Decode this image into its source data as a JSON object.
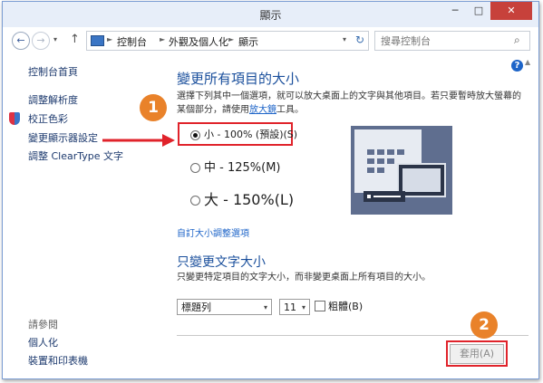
{
  "window": {
    "title": "顯示",
    "minimize": "─",
    "maximize": "□",
    "close": "✕"
  },
  "nav": {
    "back_icon": "←",
    "forward_icon": "→",
    "dropdown_icon": "▾",
    "up_icon": "↑"
  },
  "address": {
    "crumbs": [
      "控制台",
      "外觀及個人化",
      "顯示"
    ],
    "separator_icon": "►",
    "dropdown_icon": "▾",
    "refresh_icon": "↻"
  },
  "search": {
    "placeholder": "搜尋控制台",
    "icon": "⌕"
  },
  "sidebar": {
    "home": "控制台首頁",
    "items": [
      "調整解析度",
      "校正色彩",
      "變更顯示器設定",
      "調整 ClearType 文字"
    ],
    "see_also_title": "請參閱",
    "see_also": [
      "個人化",
      "裝置和印表機"
    ]
  },
  "main": {
    "heading1": "變更所有項目的大小",
    "desc1_part1": "選擇下列其中一個選項，就可以放大桌面上的文字與其他項目。若只要暫時放大螢幕的某個部分，請使用",
    "desc1_link": "放大鏡",
    "desc1_part2": "工具。",
    "options": [
      "小 - 100% (預設)(S)",
      "中 - 125%(M)",
      "大 - 150%(L)"
    ],
    "selected_option": 0,
    "custom_link": "自訂大小調整選項",
    "heading2": "只變更文字大小",
    "desc2": "只變更特定項目的文字大小，而非變更桌面上所有項目的大小。",
    "item_select": "標題列",
    "size_select": "11",
    "bold_label": "粗體(B)",
    "bold_checked": false,
    "apply_label": "套用(A)",
    "dropdown_icon": "▾"
  },
  "annotations": {
    "step1": "1",
    "step2": "2",
    "color": "#e9822a",
    "box_color": "#e0232b"
  },
  "help_icon": "?",
  "scroll_up_icon": "▲"
}
